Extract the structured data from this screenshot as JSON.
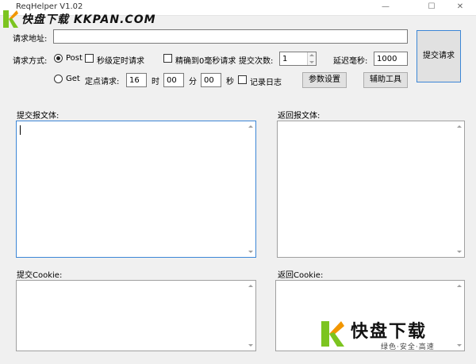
{
  "window": {
    "title": "ReqHelper V1.02",
    "minimize": "—",
    "maximize": "☐",
    "close": "✕"
  },
  "watermark": {
    "top_text": "快盘下载 KKPAN.COM",
    "bottom_title": "快盘下载",
    "bottom_sub": "绿色·安全·高速",
    "brand_green": "#7cc420",
    "brand_orange": "#f29600"
  },
  "request": {
    "url_label": "请求地址:",
    "url_value": "",
    "method_label": "请求方式:",
    "post_label": "Post",
    "get_label": "Get",
    "selected_method": "Post",
    "sec_timer_label": "秒级定时请求",
    "precise_ms_label": "精确到0毫秒请求",
    "count_label": "提交次数:",
    "count_value": "1",
    "delay_label": "延迟毫秒:",
    "delay_value": "1000",
    "fixed_label": "定点请求:",
    "hour_value": "16",
    "hour_unit": "时",
    "minute_value": "00",
    "minute_unit": "分",
    "second_value": "00",
    "second_unit": "秒",
    "log_label": "记录日志",
    "params_button": "参数设置",
    "tools_button": "辅助工具",
    "submit_button": "提交请求"
  },
  "panels": {
    "submit_body_label": "提交报文体:",
    "return_body_label": "返回报文体:",
    "submit_cookie_label": "提交Cookie:",
    "return_cookie_label": "返回Cookie:"
  }
}
